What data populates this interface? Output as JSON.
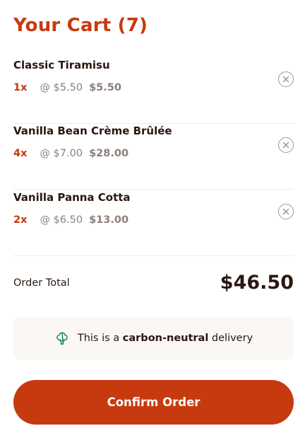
{
  "cart": {
    "title": "Your Cart (7)",
    "items": [
      {
        "name": "Classic Tiramisu",
        "quantity": "1x",
        "unit_price": "@ $5.50",
        "line_total": "$5.50"
      },
      {
        "name": "Vanilla Bean Crème Brûlée",
        "quantity": "4x",
        "unit_price": "@ $7.00",
        "line_total": "$28.00"
      },
      {
        "name": "Vanilla Panna Cotta",
        "quantity": "2x",
        "unit_price": "@ $6.50",
        "line_total": "$13.00"
      }
    ],
    "remove_icon": "remove-item-icon",
    "order_total_label": "Order Total",
    "order_total_value": "$46.50",
    "notice": {
      "prefix": "This is a ",
      "highlight": "carbon-neutral",
      "suffix": " delivery",
      "icon": "carbon-neutral-tree-icon"
    },
    "confirm_label": "Confirm Order"
  },
  "colors": {
    "accent": "#c73a0f",
    "text_dark": "#2a1711",
    "text_muted": "#8c7f79",
    "icon_green": "#1b8a5a",
    "notice_bg": "#fbf7f4"
  }
}
